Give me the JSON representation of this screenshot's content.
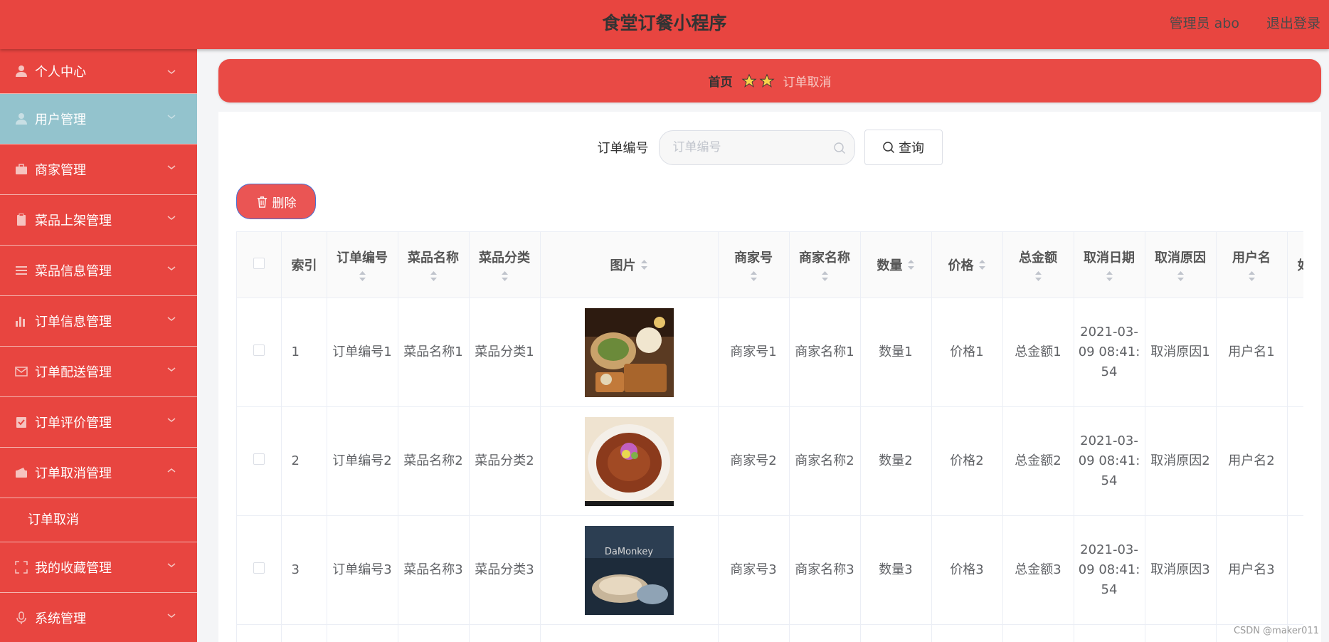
{
  "header": {
    "title": "食堂订餐小程序",
    "admin": "管理员 abo",
    "logout": "退出登录"
  },
  "sidebar": {
    "items": [
      {
        "label": "个人中心",
        "icon": "person-icon"
      },
      {
        "label": "用户管理",
        "icon": "person-icon"
      },
      {
        "label": "商家管理",
        "icon": "briefcase-icon"
      },
      {
        "label": "菜品上架管理",
        "icon": "clipboard-icon"
      },
      {
        "label": "菜品信息管理",
        "icon": "list-icon"
      },
      {
        "label": "订单信息管理",
        "icon": "bar-chart-icon"
      },
      {
        "label": "订单配送管理",
        "icon": "mail-icon"
      },
      {
        "label": "订单评价管理",
        "icon": "check-clipboard-icon"
      },
      {
        "label": "订单取消管理",
        "icon": "wallet-icon"
      },
      {
        "label": "我的收藏管理",
        "icon": "fullscreen-icon"
      },
      {
        "label": "系统管理",
        "icon": "microphone-icon"
      }
    ],
    "submenu": {
      "label": "订单取消"
    }
  },
  "breadcrumb": {
    "home": "首页",
    "current": "订单取消"
  },
  "search": {
    "label": "订单编号",
    "placeholder": "订单编号",
    "button": "查询"
  },
  "actions": {
    "delete": "删除"
  },
  "table": {
    "headers": [
      "索引",
      "订单编号",
      "菜品名称",
      "菜品分类",
      "图片",
      "商家号",
      "商家名称",
      "数量",
      "价格",
      "总金额",
      "取消日期",
      "取消原因",
      "用户名",
      "如"
    ],
    "rows": [
      {
        "index": "1",
        "order_no": "订单编号1",
        "dish_name": "菜品名称1",
        "dish_cat": "菜品分类1",
        "merchant_no": "商家号1",
        "merchant_name": "商家名称1",
        "qty": "数量1",
        "price": "价格1",
        "total": "总金额1",
        "cancel_date": "2021-03-09 08:41:54",
        "reason": "取消原因1",
        "user": "用户名1"
      },
      {
        "index": "2",
        "order_no": "订单编号2",
        "dish_name": "菜品名称2",
        "dish_cat": "菜品分类2",
        "merchant_no": "商家号2",
        "merchant_name": "商家名称2",
        "qty": "数量2",
        "price": "价格2",
        "total": "总金额2",
        "cancel_date": "2021-03-09 08:41:54",
        "reason": "取消原因2",
        "user": "用户名2"
      },
      {
        "index": "3",
        "order_no": "订单编号3",
        "dish_name": "菜品名称3",
        "dish_cat": "菜品分类3",
        "merchant_no": "商家号3",
        "merchant_name": "商家名称3",
        "qty": "数量3",
        "price": "价格3",
        "total": "总金额3",
        "cancel_date": "2021-03-09 08:41:54",
        "reason": "取消原因3",
        "user": "用户名3"
      }
    ]
  },
  "image3_text": "DaMonkey",
  "watermark": "CSDN @maker011",
  "colors": {
    "primary": "#e84540",
    "active_menu": "#93c3cd",
    "delete_button": "#ea5554"
  }
}
